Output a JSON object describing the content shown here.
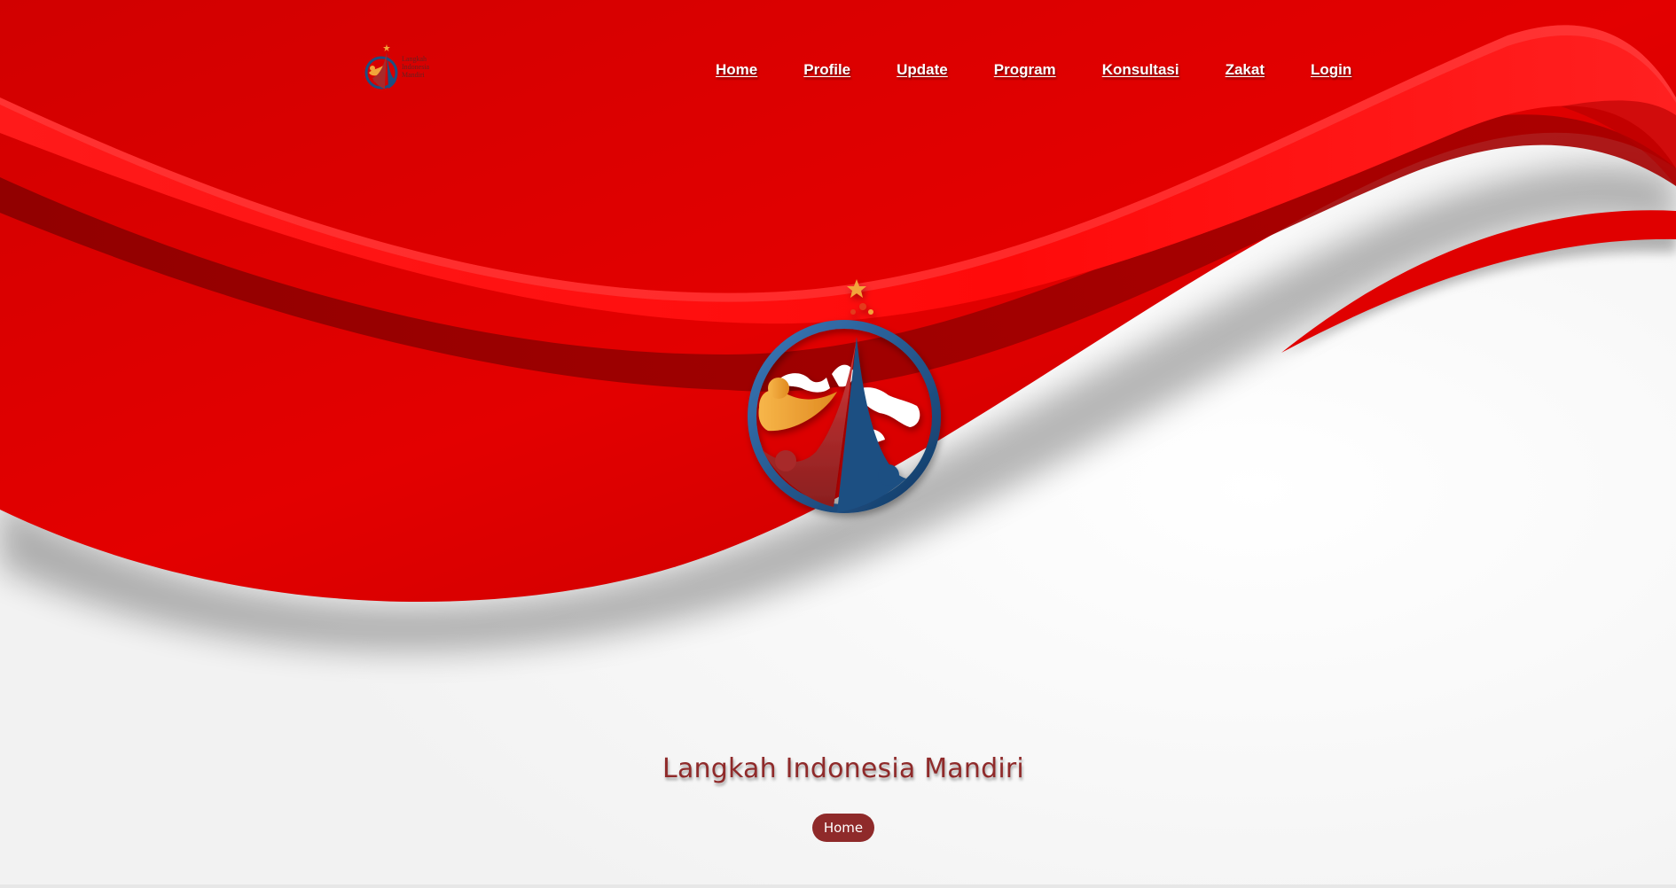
{
  "brand": {
    "name": "Langkah Indonesia Mandiri",
    "logo_lines": [
      "Langkah",
      "Indonesia",
      "Mandiri"
    ]
  },
  "nav": {
    "items": [
      "Home",
      "Profile",
      "Update",
      "Program",
      "Konsultasi",
      "Zakat",
      "Login"
    ]
  },
  "hero": {
    "title": "Langkah Indonesia Mandiri",
    "breadcrumb": "Home"
  },
  "colors": {
    "primary_red": "#e00000",
    "dark_red": "#8f2a2a",
    "navy": "#1d4f82",
    "orange": "#f2a43a"
  }
}
